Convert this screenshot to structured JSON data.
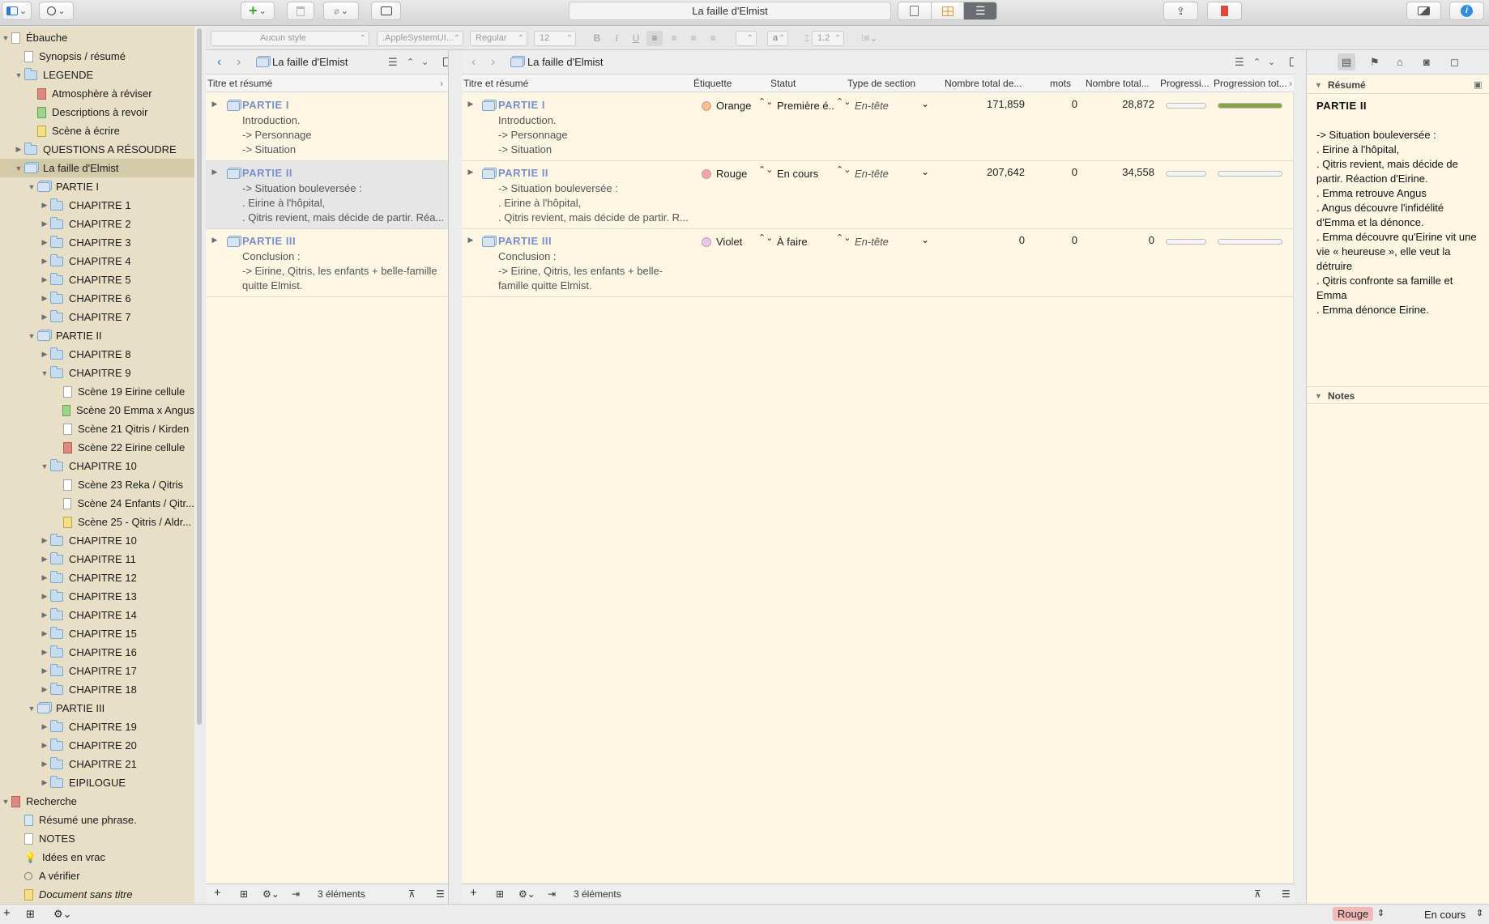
{
  "toolbar": {
    "doc_title": "La faille d'Elmist"
  },
  "format": {
    "style": "Aucun style",
    "font": ".AppleSystemUI...",
    "weight": "Regular",
    "size": "12",
    "case": "a",
    "spacing": "1.2"
  },
  "binder": {
    "items": [
      {
        "label": "Ébauche",
        "indent": 0,
        "icon": "doc",
        "disc": "▼"
      },
      {
        "label": "Synopsis / résumé",
        "indent": 1,
        "icon": "doc",
        "disc": ""
      },
      {
        "label": "LEGENDE",
        "indent": 1,
        "icon": "folder",
        "disc": "▼"
      },
      {
        "label": "Atmosphère à réviser",
        "indent": 2,
        "icon": "doc r",
        "disc": ""
      },
      {
        "label": "Descriptions à revoir",
        "indent": 2,
        "icon": "doc g",
        "disc": ""
      },
      {
        "label": "Scène à écrire",
        "indent": 2,
        "icon": "doc y",
        "disc": ""
      },
      {
        "label": "QUESTIONS A RÉSOUDRE",
        "indent": 1,
        "icon": "folder",
        "disc": "▶"
      },
      {
        "label": "La faille d'Elmist",
        "indent": 1,
        "icon": "pfolder",
        "disc": "▼",
        "sel": true
      },
      {
        "label": "PARTIE  I",
        "indent": 2,
        "icon": "pfolder",
        "disc": "▼"
      },
      {
        "label": "CHAPITRE 1",
        "indent": 3,
        "icon": "folder",
        "disc": "▶"
      },
      {
        "label": "CHAPITRE 2",
        "indent": 3,
        "icon": "folder",
        "disc": "▶"
      },
      {
        "label": "CHAPITRE 3",
        "indent": 3,
        "icon": "folder",
        "disc": "▶"
      },
      {
        "label": "CHAPITRE 4",
        "indent": 3,
        "icon": "folder",
        "disc": "▶"
      },
      {
        "label": "CHAPITRE 5",
        "indent": 3,
        "icon": "folder",
        "disc": "▶"
      },
      {
        "label": "CHAPITRE 6",
        "indent": 3,
        "icon": "folder",
        "disc": "▶"
      },
      {
        "label": "CHAPITRE 7",
        "indent": 3,
        "icon": "folder",
        "disc": "▶"
      },
      {
        "label": "PARTIE  II",
        "indent": 2,
        "icon": "pfolder",
        "disc": "▼"
      },
      {
        "label": "CHAPITRE 8",
        "indent": 3,
        "icon": "folder",
        "disc": "▶"
      },
      {
        "label": "CHAPITRE 9",
        "indent": 3,
        "icon": "folder",
        "disc": "▼"
      },
      {
        "label": "Scène 19 Eirine cellule",
        "indent": 4,
        "icon": "doc",
        "disc": ""
      },
      {
        "label": "Scène 20 Emma x Angus",
        "indent": 4,
        "icon": "doc g",
        "disc": ""
      },
      {
        "label": "Scène 21 Qitris / Kirden",
        "indent": 4,
        "icon": "doc",
        "disc": ""
      },
      {
        "label": "Scène 22 Eirine cellule",
        "indent": 4,
        "icon": "doc r",
        "disc": ""
      },
      {
        "label": "CHAPITRE 10",
        "indent": 3,
        "icon": "folder",
        "disc": "▼"
      },
      {
        "label": "Scène 23 Reka / Qitris",
        "indent": 4,
        "icon": "doc",
        "disc": ""
      },
      {
        "label": "Scène 24 Enfants / Qitr...",
        "indent": 4,
        "icon": "doc",
        "disc": ""
      },
      {
        "label": "Scène 25 - Qitris / Aldr...",
        "indent": 4,
        "icon": "doc y",
        "disc": ""
      },
      {
        "label": "CHAPITRE 10",
        "indent": 3,
        "icon": "folder",
        "disc": "▶"
      },
      {
        "label": "CHAPITRE 11",
        "indent": 3,
        "icon": "folder",
        "disc": "▶"
      },
      {
        "label": "CHAPITRE 12",
        "indent": 3,
        "icon": "folder",
        "disc": "▶"
      },
      {
        "label": "CHAPITRE 13",
        "indent": 3,
        "icon": "folder",
        "disc": "▶"
      },
      {
        "label": "CHAPITRE 14",
        "indent": 3,
        "icon": "folder",
        "disc": "▶"
      },
      {
        "label": "CHAPITRE 15",
        "indent": 3,
        "icon": "folder",
        "disc": "▶"
      },
      {
        "label": "CHAPITRE 16",
        "indent": 3,
        "icon": "folder",
        "disc": "▶"
      },
      {
        "label": "CHAPITRE 17",
        "indent": 3,
        "icon": "folder",
        "disc": "▶"
      },
      {
        "label": "CHAPITRE 18",
        "indent": 3,
        "icon": "folder",
        "disc": "▶"
      },
      {
        "label": "PARTIE  III",
        "indent": 2,
        "icon": "pfolder",
        "disc": "▼"
      },
      {
        "label": "CHAPITRE 19",
        "indent": 3,
        "icon": "folder",
        "disc": "▶"
      },
      {
        "label": "CHAPITRE 20",
        "indent": 3,
        "icon": "folder",
        "disc": "▶"
      },
      {
        "label": "CHAPITRE 21",
        "indent": 3,
        "icon": "folder",
        "disc": "▶"
      },
      {
        "label": "EIPILOGUE",
        "indent": 3,
        "icon": "folder",
        "disc": "▶"
      },
      {
        "label": "Recherche",
        "indent": 0,
        "icon": "doc r",
        "disc": "▼"
      },
      {
        "label": "Résumé une phrase.",
        "indent": 1,
        "icon": "doc b",
        "disc": ""
      },
      {
        "label": "NOTES",
        "indent": 1,
        "icon": "doc",
        "disc": ""
      },
      {
        "label": "Idées en vrac",
        "indent": 1,
        "icon": "bulb",
        "disc": ""
      },
      {
        "label": "A vérifier",
        "indent": 1,
        "icon": "search",
        "disc": ""
      },
      {
        "label": "Document sans titre",
        "indent": 1,
        "icon": "doc y",
        "disc": "",
        "italic": true
      }
    ]
  },
  "left_pane": {
    "title": "La faille d'Elmist",
    "col": "Titre et résumé",
    "footer": "3 éléments"
  },
  "right_pane": {
    "title": "La faille d'Elmist",
    "footer": "3 éléments",
    "cols": [
      "Titre et résumé",
      "Étiquette",
      "Statut",
      "Type de section",
      "Nombre total de...",
      "mots",
      "Nombre total...",
      "Progressi...",
      "Progression tot..."
    ]
  },
  "rows": [
    {
      "title": "PARTIE  I",
      "lines": [
        "Introduction.",
        "-> Personnage",
        "-> Situation"
      ],
      "lines_r": [
        "Introduction.",
        "-> Personnage",
        "-> Situation"
      ],
      "label": "Orange",
      "label_color": "#f4c08c",
      "status": "Première é...",
      "section": "En-tête",
      "total": "171,859",
      "mots": "0",
      "total2": "28,872",
      "prog": 0,
      "prog_total": 1.0
    },
    {
      "title": "PARTIE  II",
      "lines": [
        "-> Situation bouleversée :",
        ". Eirine à l'hôpital,",
        ". Qitris revient, mais décide de partir. Réa..."
      ],
      "lines_r": [
        "-> Situation bouleversée :",
        ". Eirine à l'hôpital,",
        ". Qitris revient, mais décide de partir. R..."
      ],
      "label": "Rouge",
      "label_color": "#f2a6a6",
      "status": "En cours",
      "section": "En-tête",
      "total": "207,642",
      "mots": "0",
      "total2": "34,558",
      "prog": 0,
      "prog_total": 0
    },
    {
      "title": "PARTIE  III",
      "lines": [
        "Conclusion :",
        "-> Eirine, Qitris, les enfants + belle-famille",
        "quitte Elmist."
      ],
      "lines_r": [
        "Conclusion :",
        "-> Eirine, Qitris, les enfants + belle-",
        "famille quitte Elmist."
      ],
      "label": "Violet",
      "label_color": "#e6c6ee",
      "status": "À faire",
      "section": "En-tête",
      "total": "0",
      "mots": "0",
      "total2": "0",
      "prog": 0,
      "prog_total": 0
    }
  ],
  "inspector": {
    "resume_label": "Résumé",
    "title": "PARTIE  II",
    "lines": [
      "-> Situation bouleversée :",
      ". Eirine à l'hôpital,",
      ". Qitris revient, mais décide de",
      "partir. Réaction d'Eirine.",
      ". Emma retrouve Angus",
      ". Angus découvre l'infidélité",
      "d'Emma et la dénonce.",
      ". Emma découvre qu'Eirine vit une",
      "vie « heureuse », elle veut la",
      "détruire",
      ". Qitris confronte sa famille et",
      "Emma",
      ". Emma dénonce Eirine."
    ],
    "notes_label": "Notes"
  },
  "statusbar": {
    "label": "Rouge",
    "status": "En cours"
  }
}
